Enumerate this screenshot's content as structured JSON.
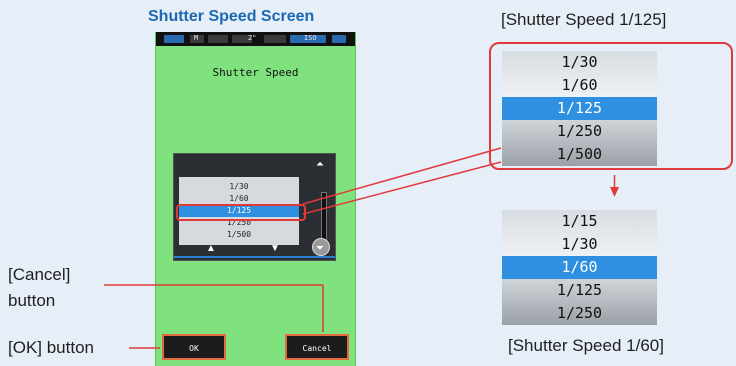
{
  "captions": {
    "left_title": "Shutter Speed Screen",
    "top_right": "[Shutter Speed 1/125]",
    "bottom_right": "[Shutter Speed 1/60]",
    "cancel_label_line1": "[Cancel]",
    "cancel_label_line2": "button",
    "ok_label": "[OK] button"
  },
  "device": {
    "status_bar": {
      "seg1": "M",
      "seg2": "2\"",
      "seg3": "ISO"
    },
    "screen_title": "Shutter Speed",
    "picker_items": [
      "1/30",
      "1/60",
      "1/125",
      "1/250",
      "1/500"
    ],
    "selected_index": 2,
    "ok_button": "OK",
    "cancel_button": "Cancel"
  },
  "zoom_top": {
    "items": [
      "1/30",
      "1/60",
      "1/125",
      "1/250",
      "1/500"
    ],
    "selected_index": 2
  },
  "zoom_bottom": {
    "items": [
      "1/15",
      "1/30",
      "1/60",
      "1/125",
      "1/250"
    ],
    "selected_index": 2
  },
  "colors": {
    "screen_green": "#7fe27f",
    "selection_blue": "#2f8fe0",
    "callout_red": "#e03a3a",
    "caption_blue": "#1b69b3"
  }
}
